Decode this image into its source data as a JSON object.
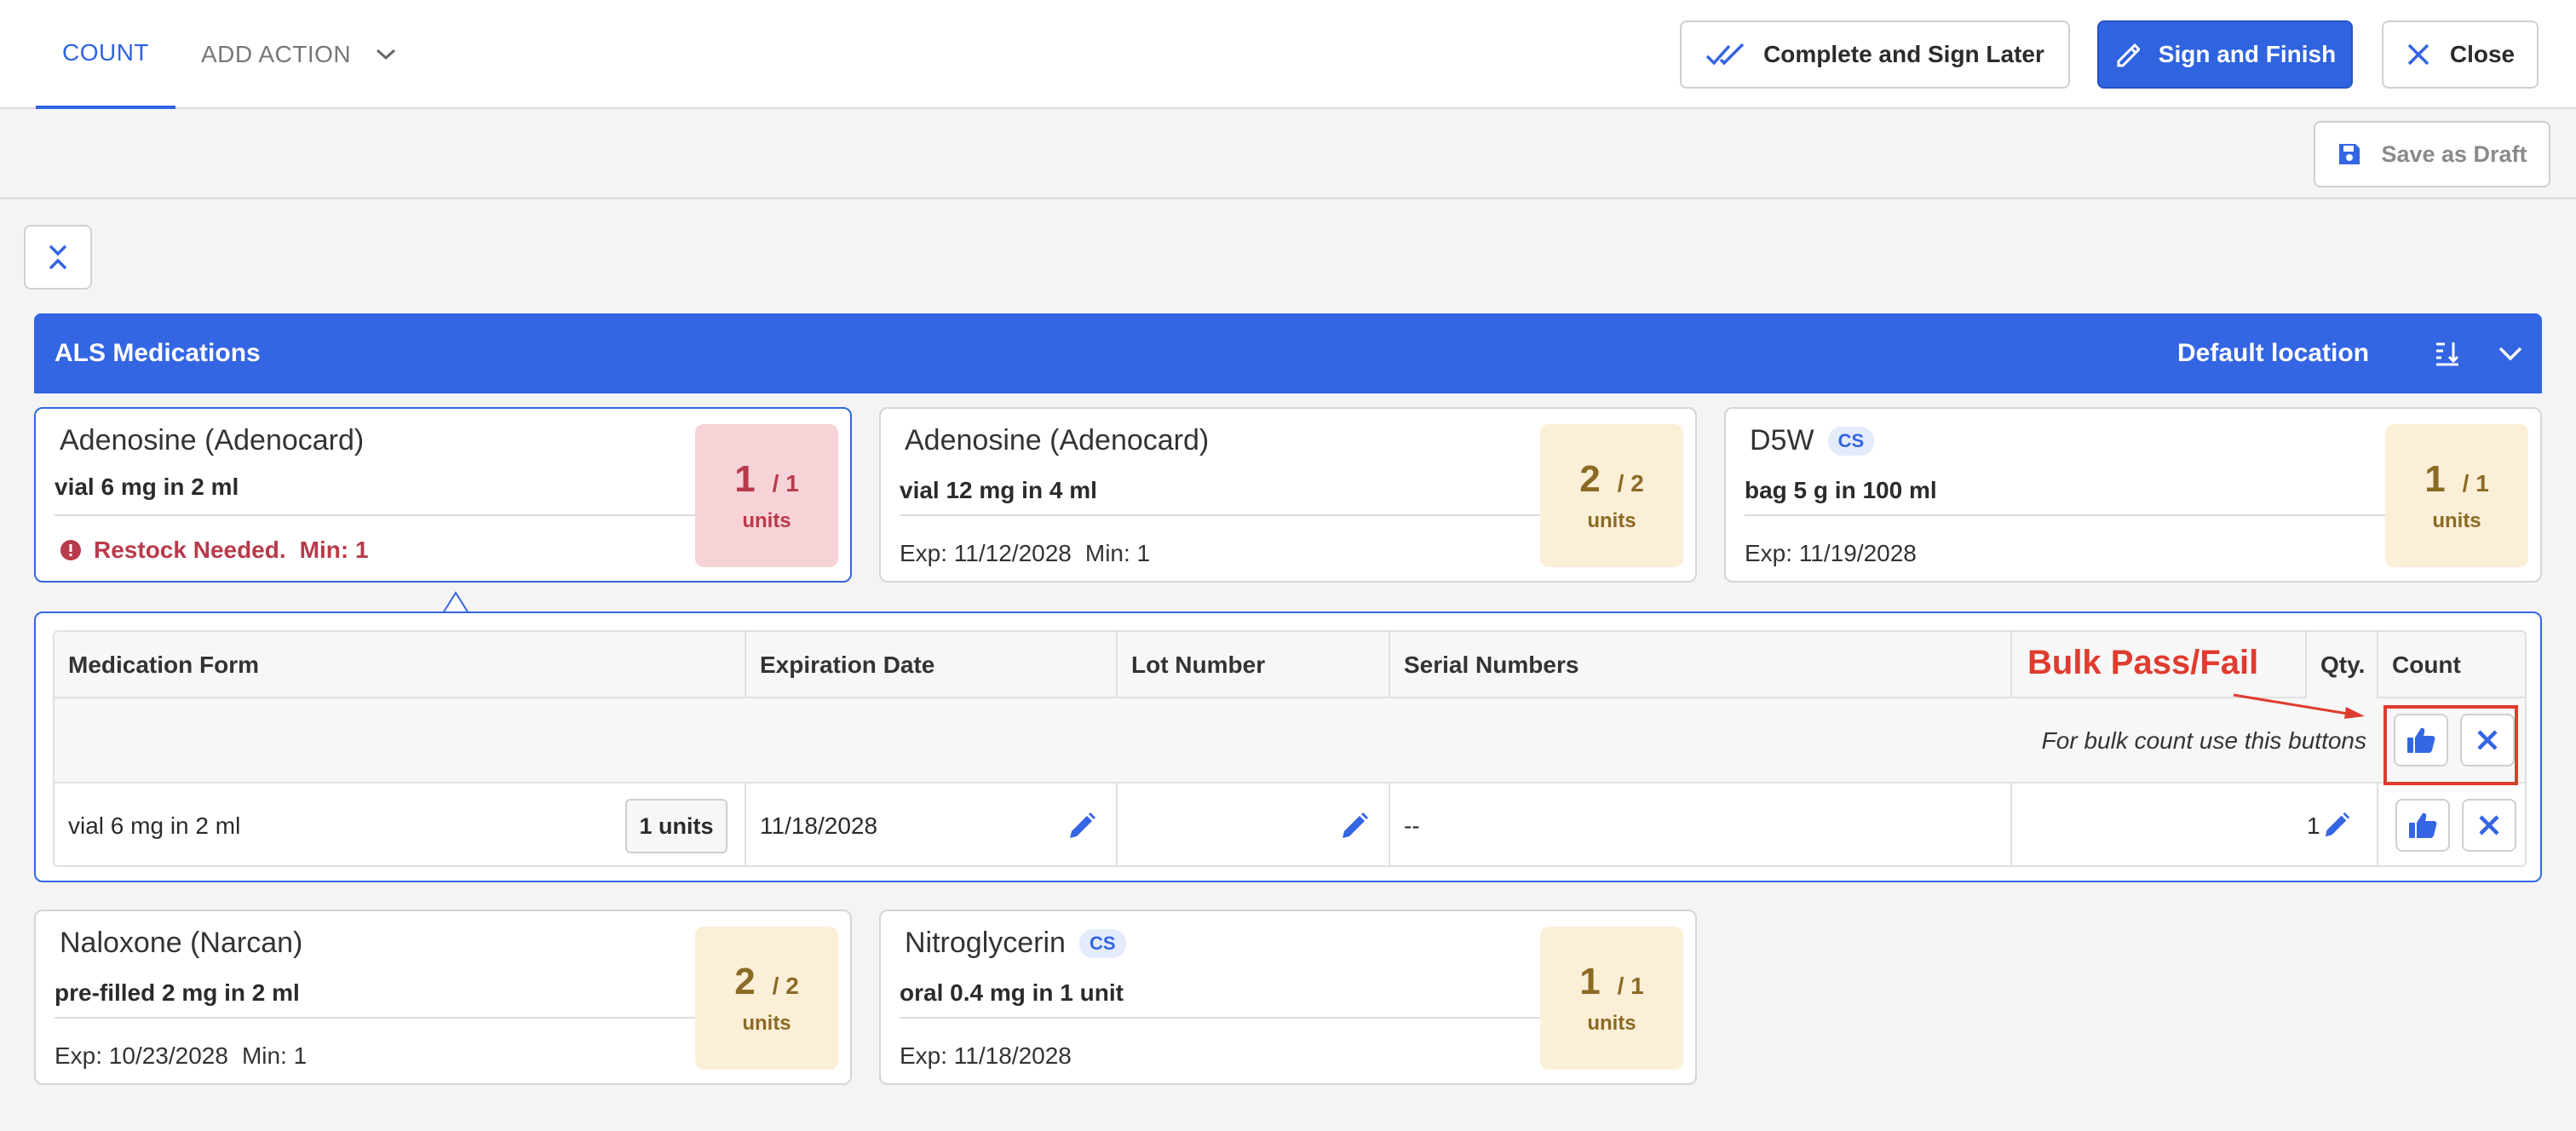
{
  "header": {
    "tabs": [
      {
        "label": "COUNT",
        "active": true
      },
      {
        "label": "ADD ACTION",
        "active": false
      }
    ],
    "buttons": {
      "complete_later": "Complete and Sign Later",
      "sign_finish": "Sign and Finish",
      "close": "Close"
    }
  },
  "subbar": {
    "save_draft": "Save as Draft"
  },
  "group": {
    "title": "ALS Medications",
    "location": "Default location"
  },
  "cards": [
    {
      "name": "Adenosine (Adenocard)",
      "form": "vial 6 mg in 2 ml",
      "alert": "Restock Needed.",
      "min": "Min: 1",
      "count": "1",
      "of": "/ 1",
      "unit": "units"
    },
    {
      "name": "Adenosine (Adenocard)",
      "form": "vial 12 mg in 4 ml",
      "exp": "Exp: 11/12/2028",
      "min": "Min: 1",
      "count": "2",
      "of": "/ 2",
      "unit": "units"
    },
    {
      "name": "D5W",
      "badge": "CS",
      "form": "bag 5 g in 100 ml",
      "exp": "Exp: 11/19/2028",
      "count": "1",
      "of": "/ 1",
      "unit": "units"
    },
    {
      "name": "Naloxone (Narcan)",
      "form": "pre-filled 2 mg in 2 ml",
      "exp": "Exp: 10/23/2028",
      "min": "Min: 1",
      "count": "2",
      "of": "/ 2",
      "unit": "units"
    },
    {
      "name": "Nitroglycerin",
      "badge": "CS",
      "form": "oral 0.4 mg in 1 unit",
      "exp": "Exp: 11/18/2028",
      "count": "1",
      "of": "/ 1",
      "unit": "units"
    }
  ],
  "detail_table": {
    "columns": [
      "Medication Form",
      "Expiration Date",
      "Lot Number",
      "Serial Numbers",
      "",
      "Qty.",
      "Count"
    ],
    "bulk_hint": "For bulk count use this buttons",
    "row": {
      "form": "vial 6 mg in 2 ml",
      "units": "1 units",
      "expiration": "11/18/2028",
      "lot": "",
      "serial": "--",
      "qty": "1"
    }
  },
  "annotation": {
    "label": "Bulk Pass/Fail"
  },
  "colors": {
    "accent": "#3465e3",
    "danger": "#b83a4b",
    "warn_bg": "#fcefd8",
    "annotation": "#e03b2f"
  }
}
